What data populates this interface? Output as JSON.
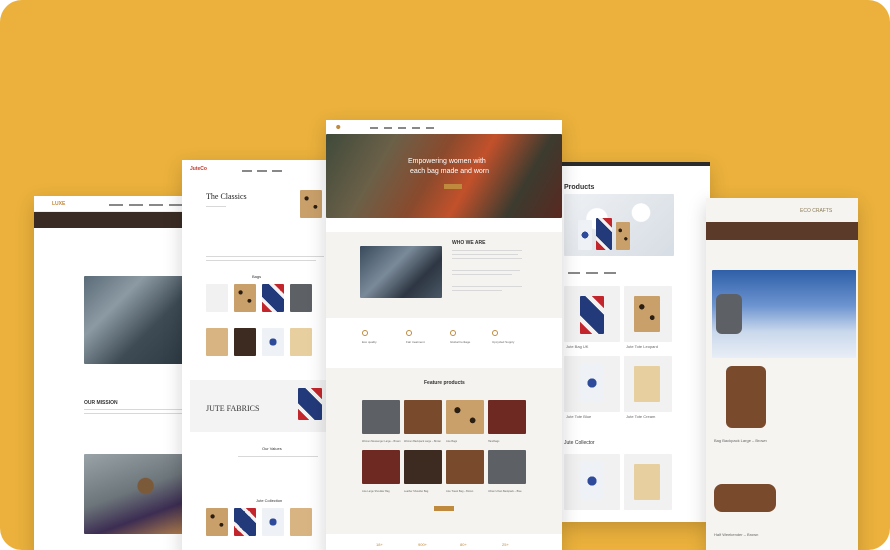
{
  "colors": {
    "background": "#EBB13C",
    "accent": "#C08A3E",
    "nav_dark": "#2b2b2b"
  },
  "page_left": {
    "brand": "LUXE",
    "mission_heading": "OUR MISSION"
  },
  "page_left2": {
    "brand": "JuteCo",
    "title": "The Classics",
    "section_bags": "Bags",
    "banner_title": "JUTE FABRICS",
    "section_ours": "Our Values",
    "section_collection": "Jute Collection"
  },
  "page_center": {
    "hero_line1": "Empowering women with",
    "hero_line2": "each bag made and worn",
    "who_heading": "WHO WE ARE",
    "feature_heading": "Feature products",
    "features": [
      "Eco quality",
      "Fair treatment",
      "Global heritage",
      "Upcycled Supply"
    ],
    "products": [
      "Women Messenger Large – Brown",
      "Women Backpack Large – Brown",
      "Jute Bags",
      "Handbags",
      "Jute Large Shoulder Bag",
      "Leather Shoulder Bag",
      "Jute Travel Bag – Brown",
      "Urban Urban Backpack – Blue"
    ],
    "stats": [
      "18+",
      "900+",
      "80+",
      "25+"
    ]
  },
  "page_right": {
    "products_heading": "Products",
    "collection_heading": "Jute Collector",
    "captions": [
      "Jute Bag UK",
      "Jute Tote Leopard",
      "Jute Tote Blue",
      "Jute Tote Cream"
    ]
  },
  "page_far_right": {
    "brand": "ECO CRAFTS",
    "captions": [
      "Bag Backpack Large – Brown",
      "Half Weekender – Brown"
    ]
  }
}
